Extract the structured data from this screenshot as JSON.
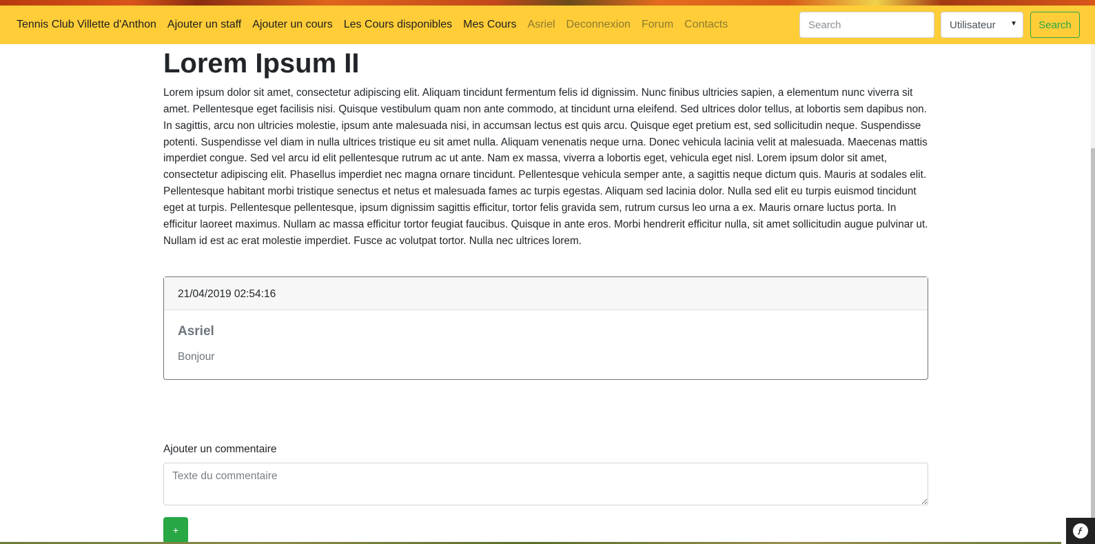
{
  "navbar": {
    "brand": "Tennis Club Villette d'Anthon",
    "links": [
      {
        "label": "Ajouter un staff"
      },
      {
        "label": "Ajouter un cours"
      },
      {
        "label": "Les Cours disponibles"
      },
      {
        "label": "Mes Cours"
      },
      {
        "label": "Asriel"
      },
      {
        "label": "Deconnexion"
      },
      {
        "label": "Forum"
      },
      {
        "label": "Contacts"
      }
    ],
    "search_placeholder": "Search",
    "select_value": "Utilisateur",
    "search_button": "Search",
    "bg_color": "#ffcd38"
  },
  "post": {
    "title": "Lorem Ipsum II",
    "body": "Lorem ipsum dolor sit amet, consectetur adipiscing elit. Aliquam tincidunt fermentum felis id dignissim. Nunc finibus ultricies sapien, a elementum nunc viverra sit amet. Pellentesque eget facilisis nisi. Quisque vestibulum quam non ante commodo, at tincidunt urna eleifend. Sed ultrices dolor tellus, at lobortis sem dapibus non. In sagittis, arcu non ultricies molestie, ipsum ante malesuada nisi, in accumsan lectus est quis arcu. Quisque eget pretium est, sed sollicitudin neque. Suspendisse potenti. Suspendisse vel diam in nulla ultrices tristique eu sit amet nulla. Aliquam venenatis neque urna. Donec vehicula lacinia velit at malesuada. Maecenas mattis imperdiet congue. Sed vel arcu id elit pellentesque rutrum ac ut ante. Nam ex massa, viverra a lobortis eget, vehicula eget nisl. Lorem ipsum dolor sit amet, consectetur adipiscing elit. Phasellus imperdiet nec magna ornare tincidunt. Pellentesque vehicula semper ante, a sagittis neque dictum quis. Mauris at sodales elit. Pellentesque habitant morbi tristique senectus et netus et malesuada fames ac turpis egestas. Aliquam sed lacinia dolor. Nulla sed elit eu turpis euismod tincidunt eget at turpis. Pellentesque pellentesque, ipsum dignissim sagittis efficitur, tortor felis gravida sem, rutrum cursus leo urna a ex. Mauris ornare luctus porta. In efficitur laoreet maximus. Nullam ac massa efficitur tortor feugiat faucibus. Quisque in ante eros. Morbi hendrerit efficitur nulla, sit amet sollicitudin augue pulvinar ut. Nullam id est ac erat molestie imperdiet. Fusce ac volutpat tortor. Nulla nec ultrices lorem."
  },
  "comments": [
    {
      "date": "21/04/2019 02:54:16",
      "author": "Asriel",
      "text": "Bonjour"
    }
  ],
  "comment_form": {
    "label": "Ajouter un commentaire",
    "placeholder": "Texte du commentaire",
    "submit_label": "+"
  },
  "colors": {
    "accent_green": "#28a745",
    "muted_text": "#6c757d"
  }
}
